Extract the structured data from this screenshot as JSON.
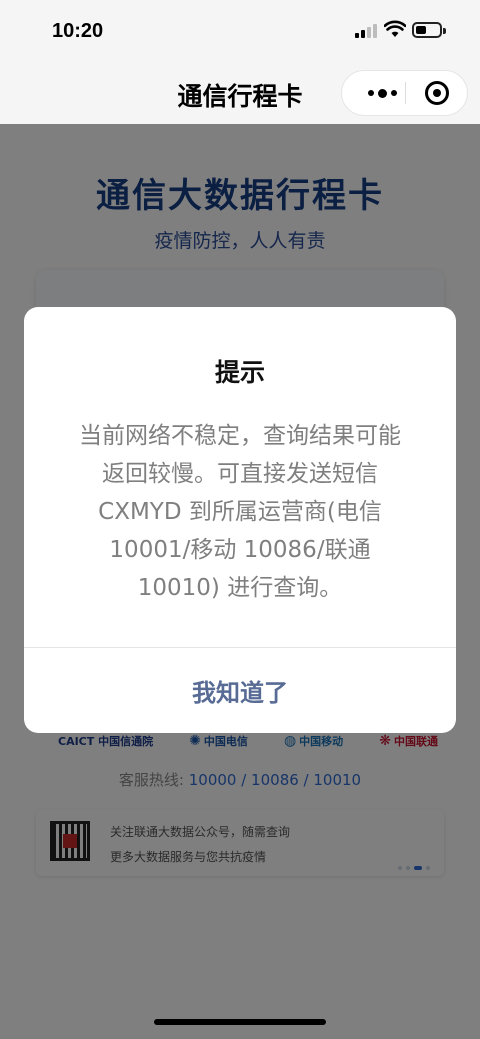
{
  "status_bar": {
    "time": "10:20",
    "icons": [
      "cellular-signal-icon",
      "wifi-icon",
      "battery-icon"
    ]
  },
  "nav": {
    "title": "通信行程卡",
    "capsule": {
      "more_icon": "more-dots-icon",
      "close_icon": "target-circle-icon"
    }
  },
  "page": {
    "heading": "通信大数据行程卡",
    "slogan": "疫情防控，人人有责",
    "partners": {
      "caict": "CAICT 中国信通院",
      "telecom": "中国电信",
      "mobile": "中国移动",
      "unicom": "中国联通"
    },
    "hotline_label": "客服热线:",
    "hotline_numbers": "10000 / 10086 / 10010",
    "promo": {
      "line1": "关注联通大数据公众号，随需查询",
      "line2": "更多大数据服务与您共抗疫情",
      "qr_icon": "qr-code-icon"
    }
  },
  "dialog": {
    "title": "提示",
    "message": "当前网络不稳定，查询结果可能返回较慢。可直接发送短信 CXMYD 到所属运营商(电信 10001/移动 10086/联通 10010) 进行查询。",
    "confirm_label": "我知道了"
  },
  "colors": {
    "heading": "#163e87",
    "dialog_button": "#576b95",
    "link": "#2f6bd3",
    "overlay": "rgba(0,0,0,0.5)"
  }
}
